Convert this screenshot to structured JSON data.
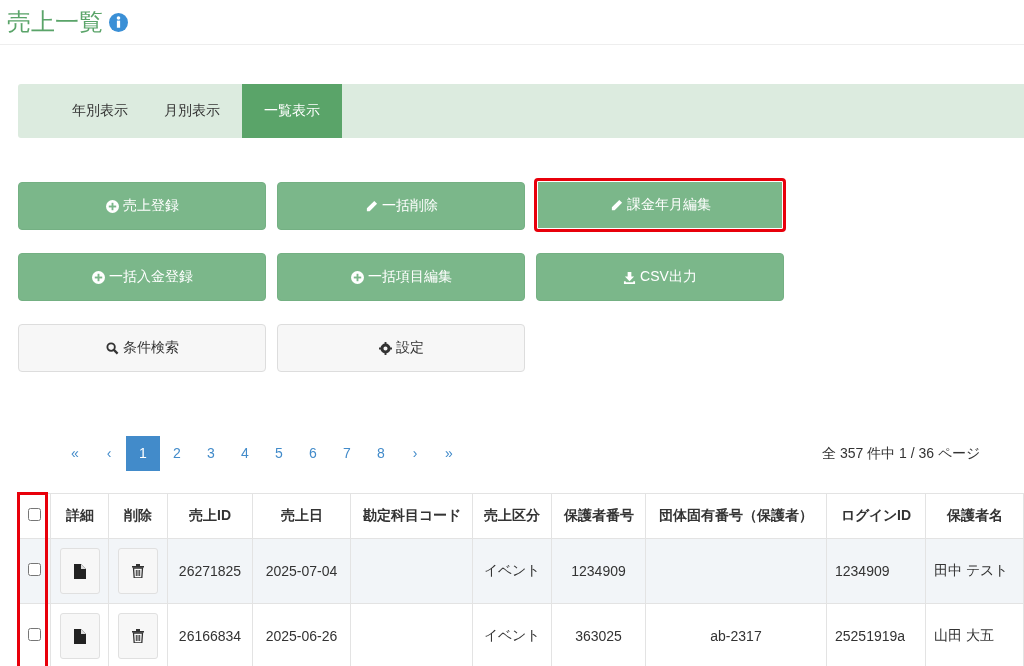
{
  "page": {
    "title": "売上一覧"
  },
  "tabs": [
    {
      "label": "年別表示",
      "selected": false
    },
    {
      "label": "月別表示",
      "selected": false
    },
    {
      "label": "一覧表示",
      "selected": true
    }
  ],
  "actions": [
    {
      "label": "売上登録",
      "highlighted": false
    },
    {
      "label": "一括削除",
      "highlighted": false
    },
    {
      "label": "課金年月編集",
      "highlighted": true
    },
    {
      "label": "一括入金登録",
      "highlighted": false
    },
    {
      "label": "一括項目編集",
      "highlighted": false
    },
    {
      "label": "CSV出力",
      "highlighted": false
    },
    {
      "label": "条件検索",
      "highlighted": false
    },
    {
      "label": "設定",
      "highlighted": false
    }
  ],
  "pagination": {
    "first": "«",
    "prev": "‹",
    "pages": [
      {
        "label": "1",
        "selected": true
      },
      {
        "label": "2",
        "selected": false
      },
      {
        "label": "3",
        "selected": false
      },
      {
        "label": "4",
        "selected": false
      },
      {
        "label": "5",
        "selected": false
      },
      {
        "label": "6",
        "selected": false
      },
      {
        "label": "7",
        "selected": false
      },
      {
        "label": "8",
        "selected": false
      }
    ],
    "next": "›",
    "last": "»",
    "summary": "全 357 件中 1 / 36 ページ"
  },
  "table": {
    "select_column_highlighted": true,
    "header_checked": false,
    "action_columns": [
      "詳細",
      "削除"
    ],
    "columns": [
      "売上ID",
      "売上日",
      "勘定科目コード",
      "売上区分",
      "保護者番号",
      "団体固有番号（保護者）",
      "ログインID",
      "保護者名"
    ],
    "rows": [
      {
        "checked": false,
        "cells": [
          "26271825",
          "2025-07-04",
          "",
          "イベント",
          "1234909",
          "",
          "1234909",
          "田中 テスト"
        ]
      },
      {
        "checked": false,
        "cells": [
          "26166834",
          "2025-06-26",
          "",
          "イベント",
          "363025",
          "ab-2317",
          "25251919a",
          "山田 大五"
        ]
      }
    ]
  }
}
